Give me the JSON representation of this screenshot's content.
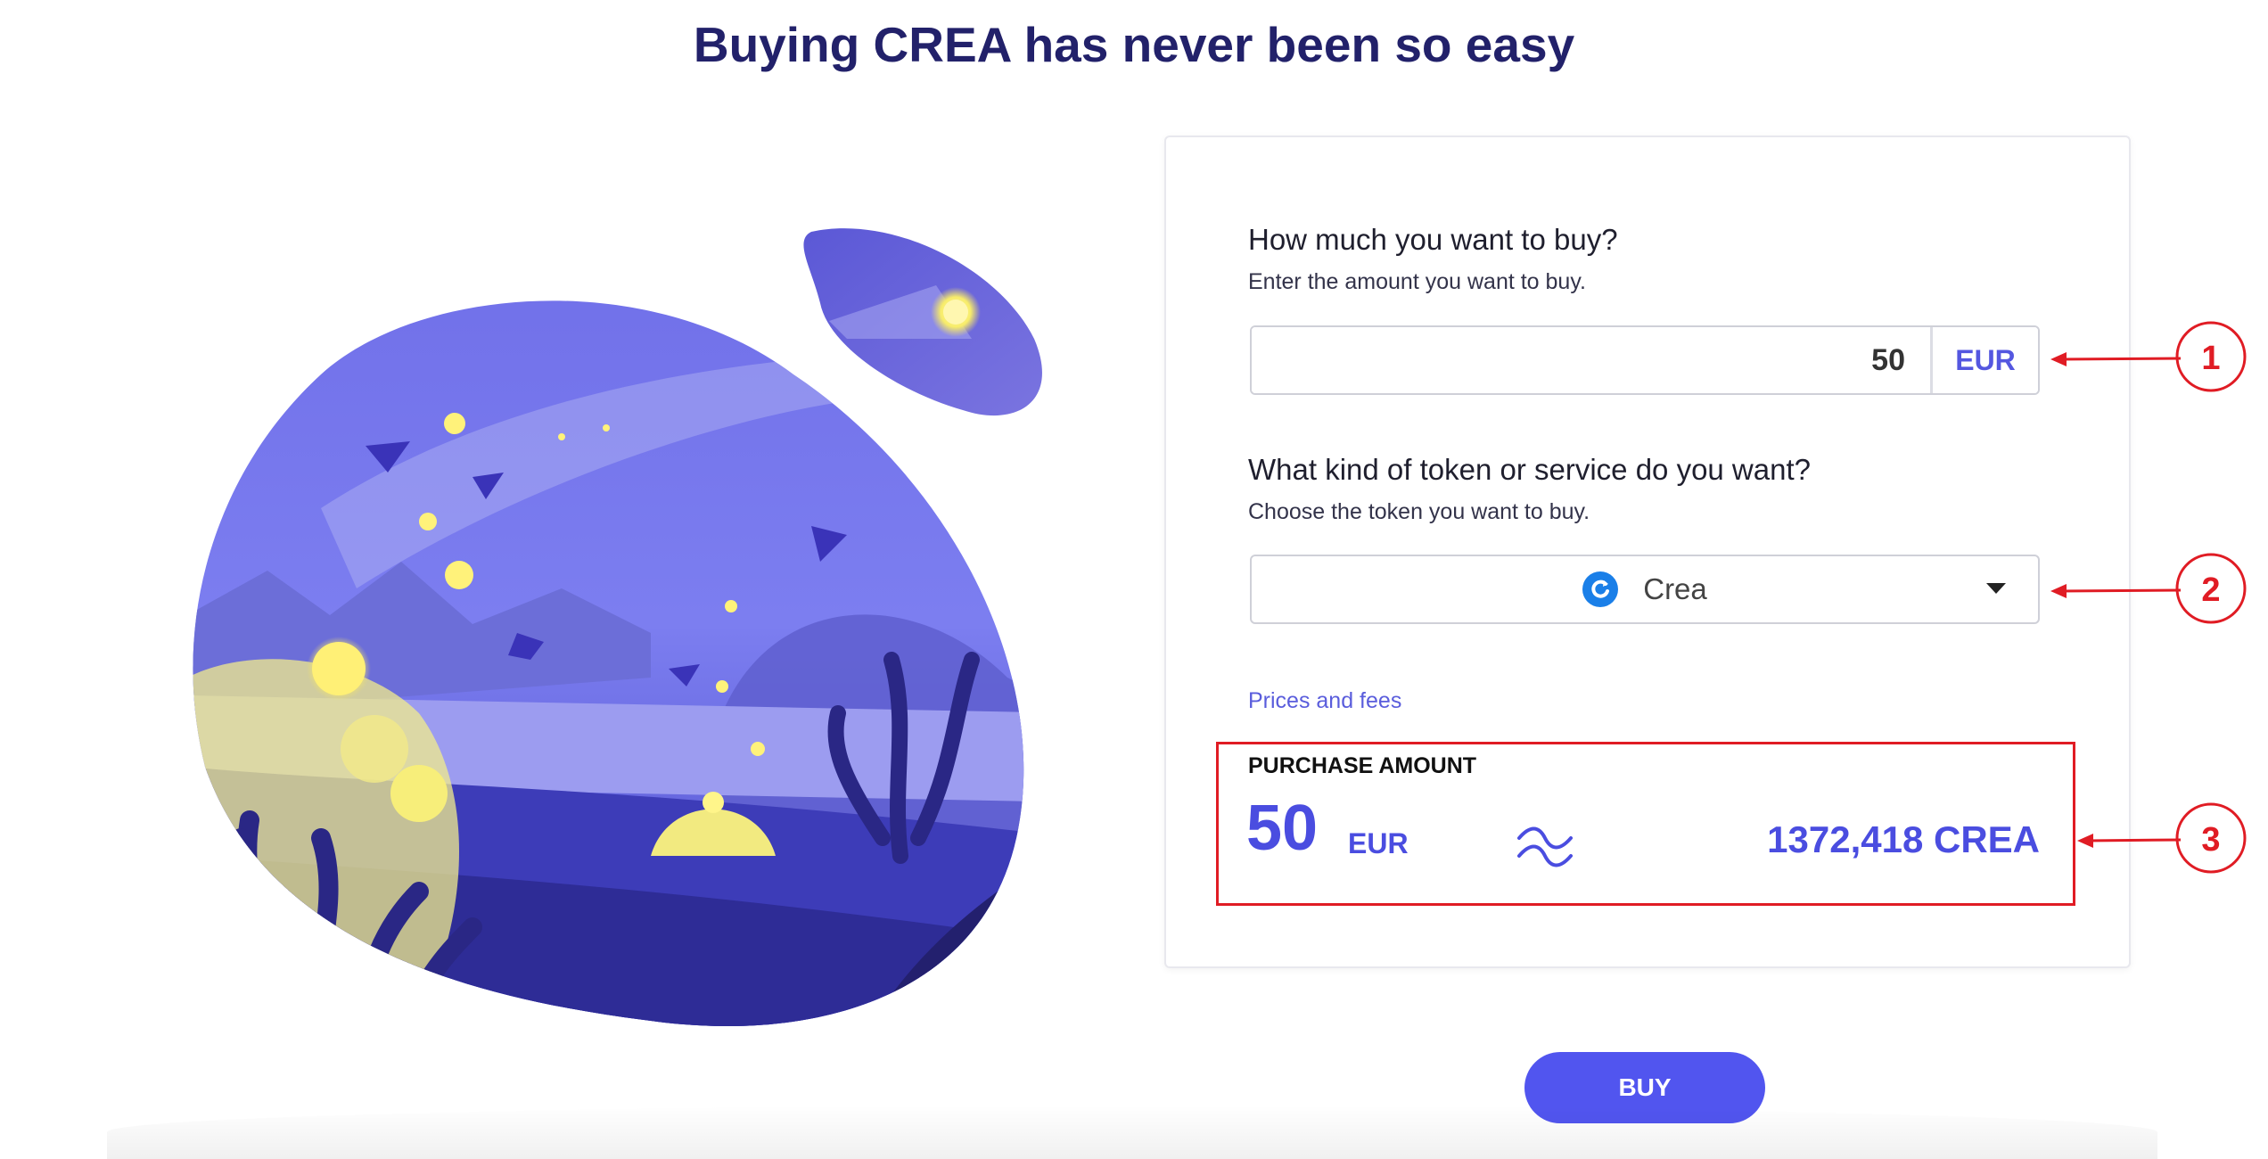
{
  "page": {
    "title": "Buying CREA has never been so easy"
  },
  "form": {
    "amount_question": "How much you want to buy?",
    "amount_hint": "Enter the amount you want to buy.",
    "amount_value": "50",
    "amount_currency": "EUR",
    "token_question": "What kind of token or service do you want?",
    "token_hint": "Choose the token you want to buy.",
    "token_selected": "Crea",
    "prices_link": "Prices and fees"
  },
  "purchase": {
    "label": "PURCHASE AMOUNT",
    "amount": "50",
    "currency": "EUR",
    "result": "1372,418 CREA"
  },
  "buy_button": "BUY",
  "annotations": [
    "1",
    "2",
    "3"
  ],
  "colors": {
    "title": "#22216a",
    "accent": "#5155ef",
    "annotation": "#e01c24"
  }
}
